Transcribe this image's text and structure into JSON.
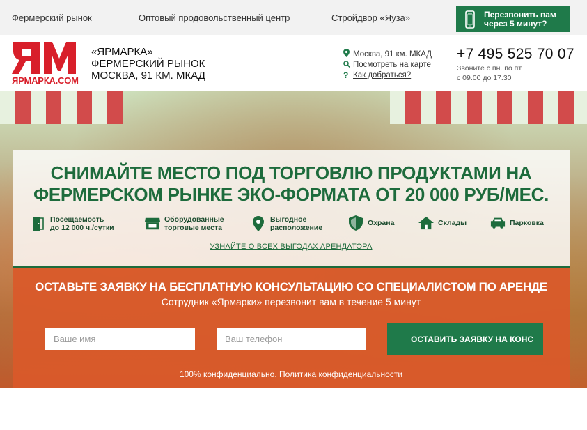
{
  "topbar": {
    "links": [
      "Фермерский рынок",
      "Оптовый продовольственный центр",
      "Стройдвор «Яуза»"
    ],
    "callback": "Перезвонить вам\nчерез 5 минут?"
  },
  "header": {
    "logo_text": "ЯРМАРКА.COM",
    "brand": [
      "«ЯРМАРКА»",
      "ФЕРМЕРСКИЙ РЫНОК",
      "МОСКВА, 91 КМ. МКАД"
    ],
    "address": "Москва, 91 км. МКАД",
    "map_link": "Посмотреть на карте",
    "route_link": "Как добраться?",
    "phone": "+7 495 525 70 07",
    "hours": "Звоните с пн. по пт.\nс 09.00 до 17.30"
  },
  "hero": {
    "headline": "СНИМАЙТЕ МЕСТО  ПОД ТОРГОВЛЮ ПРОДУКТАМИ НА\nФЕРМЕРСКОМ РЫНКЕ ЭКО-ФОРМАТА ОТ 20 000  РУБ/МЕС.",
    "features": [
      {
        "icon": "door-icon",
        "label": "Посещаемость\nдо 12 000 ч./сутки"
      },
      {
        "icon": "shop-icon",
        "label": "Оборудованные\nторговые места"
      },
      {
        "icon": "location-icon",
        "label": "Выгодное\nрасположение"
      },
      {
        "icon": "shield-icon",
        "label": "Охрана"
      },
      {
        "icon": "house-icon",
        "label": "Склады"
      },
      {
        "icon": "car-icon",
        "label": "Парковка"
      }
    ],
    "benefits_link": "УЗНАЙТЕ О ВСЕХ ВЫГОДАХ АРЕНДАТОРА"
  },
  "form": {
    "title": "ОСТАВЬТЕ ЗАЯВКУ НА БЕСПЛАТНУЮ КОНСУЛЬТАЦИЮ СО СПЕЦИАЛИСТОМ ПО АРЕНДЕ",
    "subtitle": "Сотрудник «Ярмарки» перезвонит вам в течение 5 минут",
    "name_placeholder": "Ваше имя",
    "phone_placeholder": "Ваш телефон",
    "submit": "ОСТАВИТЬ ЗАЯВКУ НА КОНС",
    "privacy_text": "100% конфиденциально.",
    "privacy_link": "Политика конфиденциальности"
  },
  "colors": {
    "green": "#1f7a4a",
    "orange": "#d9592a",
    "red": "#d81f2a"
  }
}
